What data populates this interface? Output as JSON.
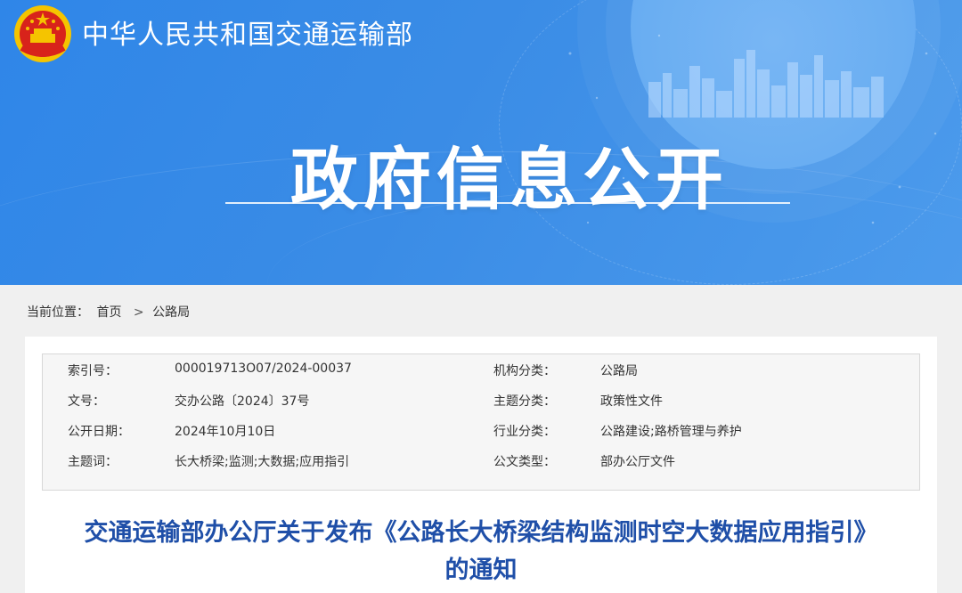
{
  "header": {
    "ministry_name": "中华人民共和国交通运输部",
    "hero_title": "政府信息公开"
  },
  "breadcrumb": {
    "prefix": "当前位置：",
    "home": "首页",
    "separator": ">",
    "current": "公路局"
  },
  "meta": {
    "rows": [
      {
        "k1": "索引号：",
        "v1": "000019713O07/2024-00037",
        "k2": "机构分类：",
        "v2": "公路局"
      },
      {
        "k1": "文号：",
        "v1": "交办公路〔2024〕37号",
        "k2": "主题分类：",
        "v2": "政策性文件"
      },
      {
        "k1": "公开日期：",
        "v1": "2024年10月10日",
        "k2": "行业分类：",
        "v2": "公路建设;路桥管理与养护"
      },
      {
        "k1": "主题词：",
        "v1": "长大桥梁;监测;大数据;应用指引",
        "k2": "公文类型：",
        "v2": "部办公厅文件"
      }
    ]
  },
  "document": {
    "title_line1": "交通运输部办公厅关于发布《公路长大桥梁结构监测时空大数据应用指引》",
    "title_line2": "的通知"
  },
  "colors": {
    "banner_blue": "#2f86e8",
    "title_blue": "#1f4fa8",
    "emblem_red": "#d8231b",
    "emblem_gold": "#f5c400"
  }
}
